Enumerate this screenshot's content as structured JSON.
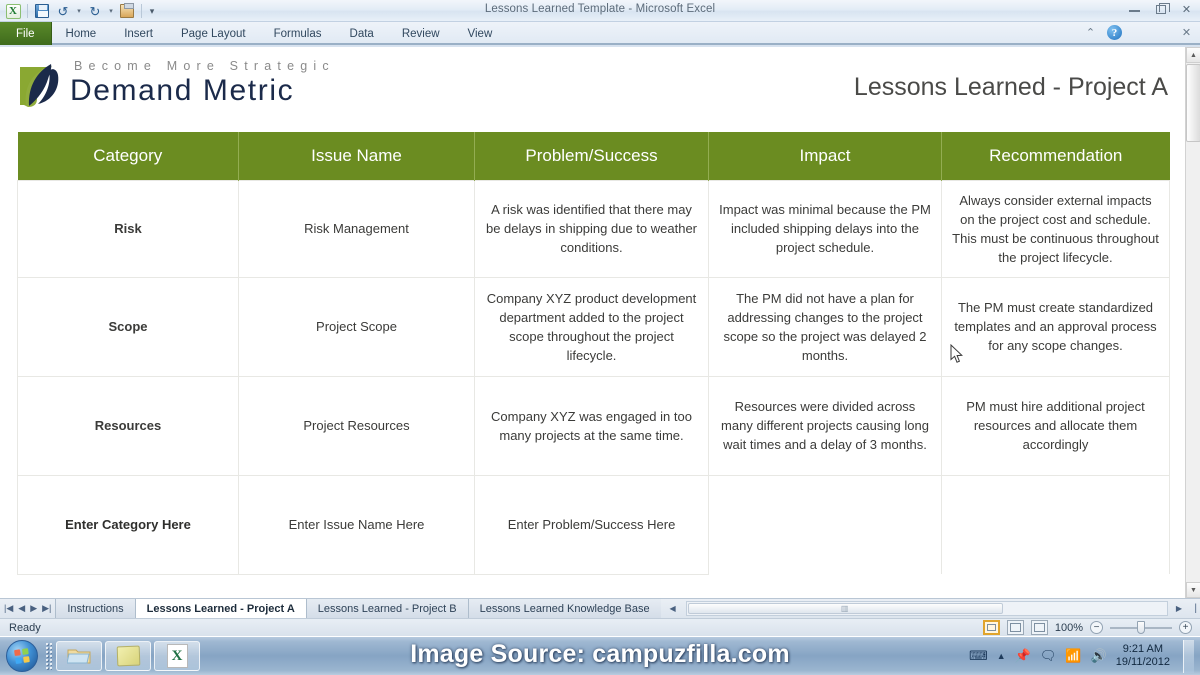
{
  "window": {
    "title": "Lessons Learned Template  -  Microsoft Excel",
    "minimize_label": "Minimize",
    "restore_label": "Restore Down",
    "close_label": "Close"
  },
  "quick_access": {
    "app_icon": "excel-icon",
    "items": [
      {
        "name": "save-icon",
        "label": "Save"
      },
      {
        "name": "undo-icon",
        "label": "↺"
      },
      {
        "name": "undo-dropdown-icon",
        "label": "▾"
      },
      {
        "name": "redo-icon",
        "label": "↻"
      },
      {
        "name": "redo-dropdown-icon",
        "label": "▾"
      },
      {
        "name": "paste-icon",
        "label": "Paste"
      },
      {
        "name": "customize-qat-icon",
        "label": "▾"
      }
    ]
  },
  "ribbon": {
    "tabs": [
      {
        "id": "file",
        "label": "File"
      },
      {
        "id": "home",
        "label": "Home"
      },
      {
        "id": "insert",
        "label": "Insert"
      },
      {
        "id": "page-layout",
        "label": "Page Layout"
      },
      {
        "id": "formulas",
        "label": "Formulas"
      },
      {
        "id": "data",
        "label": "Data"
      },
      {
        "id": "review",
        "label": "Review"
      },
      {
        "id": "view",
        "label": "View"
      }
    ],
    "right_icons": [
      {
        "name": "minimize-ribbon-icon",
        "label": "^"
      },
      {
        "name": "help-icon",
        "label": "?"
      },
      {
        "name": "minimize-window-icon",
        "label": "—"
      },
      {
        "name": "restore-window-icon",
        "label": "❐"
      },
      {
        "name": "close-window-icon",
        "label": "✕"
      }
    ]
  },
  "branding": {
    "tagline": "Become More Strategic",
    "company": "Demand Metric",
    "accent_green": "#8aa832",
    "accent_navy": "#1b2a4a"
  },
  "sheet": {
    "title": "Lessons Learned - Project A",
    "header_color": "#6b8c21",
    "columns": [
      "Category",
      "Issue Name",
      "Problem/Success",
      "Impact",
      "Recommendation"
    ],
    "rows": [
      {
        "category": "Risk",
        "issue": "Risk Management",
        "problem": "A risk was identified that there may be delays in shipping due to weather conditions.",
        "impact": "Impact was minimal because the PM included shipping delays into the project schedule.",
        "recommendation": "Always consider external impacts on the project cost and schedule. This must be continuous throughout the project lifecycle."
      },
      {
        "category": "Scope",
        "issue": "Project Scope",
        "problem": "Company XYZ product development department added to the project scope throughout the project lifecycle.",
        "impact": "The PM did not have a plan for addressing changes to the project scope so the project was delayed 2 months.",
        "recommendation": "The PM must create standardized templates and an approval process for any scope changes."
      },
      {
        "category": "Resources",
        "issue": "Project Resources",
        "problem": "Company XYZ was engaged in too many projects at the same time.",
        "impact": "Resources were divided across many different projects causing long wait times and a delay of 3 months.",
        "recommendation": "PM must hire additional project resources and allocate them accordingly"
      },
      {
        "category": "Enter Category Here",
        "issue": "Enter Issue Name Here",
        "problem": "Enter Problem/Success Here",
        "impact": "",
        "recommendation": ""
      }
    ]
  },
  "sheet_tabs": {
    "nav": [
      "|◀",
      "◀",
      "▶",
      "▶|"
    ],
    "items": [
      {
        "label": "Instructions",
        "active": false
      },
      {
        "label": "Lessons Learned - Project A",
        "active": true
      },
      {
        "label": "Lessons Learned - Project B",
        "active": false
      },
      {
        "label": "Lessons Learned Knowledge Base",
        "active": false
      }
    ]
  },
  "status_bar": {
    "state": "Ready",
    "views": [
      {
        "name": "normal-view-button",
        "label": "Normal",
        "active": true
      },
      {
        "name": "page-layout-view-button",
        "label": "Page Layout",
        "active": false
      },
      {
        "name": "page-break-view-button",
        "label": "Page Break Preview",
        "active": false
      }
    ],
    "zoom": "100%",
    "zoom_out": "−",
    "zoom_in": "+"
  },
  "taskbar": {
    "start_label": "Start",
    "buttons": [
      {
        "name": "taskbar-explorer-button",
        "label": "Windows Explorer"
      },
      {
        "name": "taskbar-notes-button",
        "label": "Sticky Notes"
      },
      {
        "name": "taskbar-excel-button",
        "label": "Microsoft Excel"
      }
    ],
    "tray": [
      {
        "name": "keyboard-layout-icon",
        "label": "EN"
      },
      {
        "name": "show-hidden-icons-icon",
        "label": "▲"
      },
      {
        "name": "pin-icon",
        "label": "📌"
      },
      {
        "name": "action-center-icon",
        "label": "🗨"
      },
      {
        "name": "network-icon",
        "label": "📶"
      },
      {
        "name": "volume-icon",
        "label": "🔊"
      }
    ],
    "clock_time": "9:21 AM",
    "clock_date": "19/11/2012"
  },
  "overlay": {
    "watermark": "Image Source: campuzfilla.com"
  }
}
